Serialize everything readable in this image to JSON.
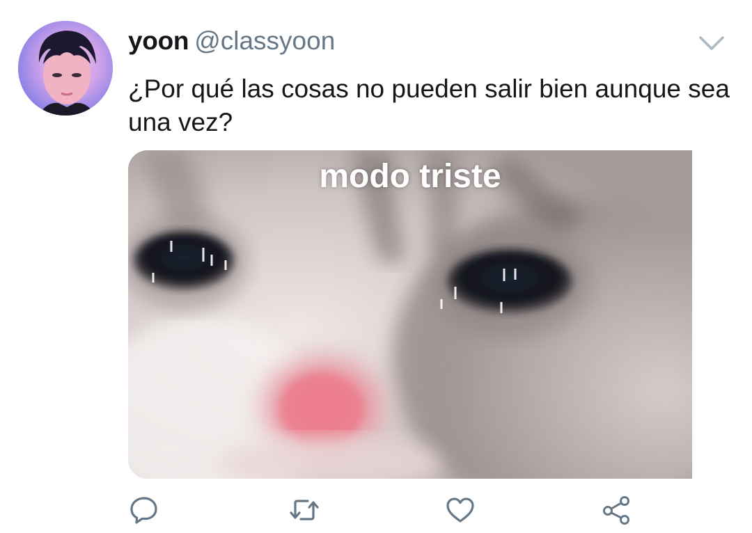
{
  "tweet": {
    "display_name": "yoon",
    "handle": "@classyoon",
    "text": "¿Por qué las cosas no pueden salir bien aunque sea una vez?",
    "media_caption": "modo triste"
  },
  "icons": {
    "menu": "chevron-down-icon",
    "reply": "reply-icon",
    "retweet": "retweet-icon",
    "like": "heart-icon",
    "share": "share-icon"
  },
  "colors": {
    "text_primary": "#14171a",
    "text_secondary": "#657786",
    "icon": "#657786"
  }
}
